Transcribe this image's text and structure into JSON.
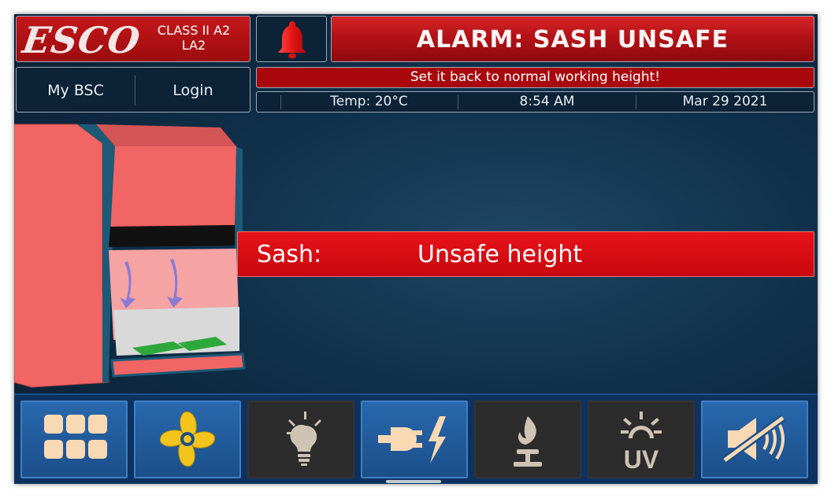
{
  "header": {
    "logo_text": "ESCO",
    "class_line1": "CLASS II A2",
    "class_line2": "LA2",
    "alarm_title": "ALARM: SASH UNSAFE",
    "alarm_icon": "bell-icon"
  },
  "nav": {
    "my_bsc": "My BSC",
    "login": "Login"
  },
  "message": "Set it back to normal working height!",
  "status": {
    "temp": "Temp: 20°C",
    "time": "8:54 AM",
    "date": "Mar 29 2021"
  },
  "sash": {
    "label": "Sash:",
    "value": "Unsafe height"
  },
  "colors": {
    "alarm_red": "#c8080e",
    "panel_blue": "#0c2236",
    "toolbar_active": "#2868ad",
    "toolbar_inactive": "#2c2c2c",
    "cabinet": "#f26565"
  },
  "toolbar": [
    {
      "name": "menu-grid-icon",
      "active": true
    },
    {
      "name": "fan-icon",
      "active": true
    },
    {
      "name": "light-bulb-icon",
      "active": false
    },
    {
      "name": "power-plug-icon",
      "active": true
    },
    {
      "name": "gas-burner-icon",
      "active": false
    },
    {
      "name": "uv-lamp-icon",
      "active": false
    },
    {
      "name": "mute-speaker-icon",
      "active": true
    }
  ]
}
